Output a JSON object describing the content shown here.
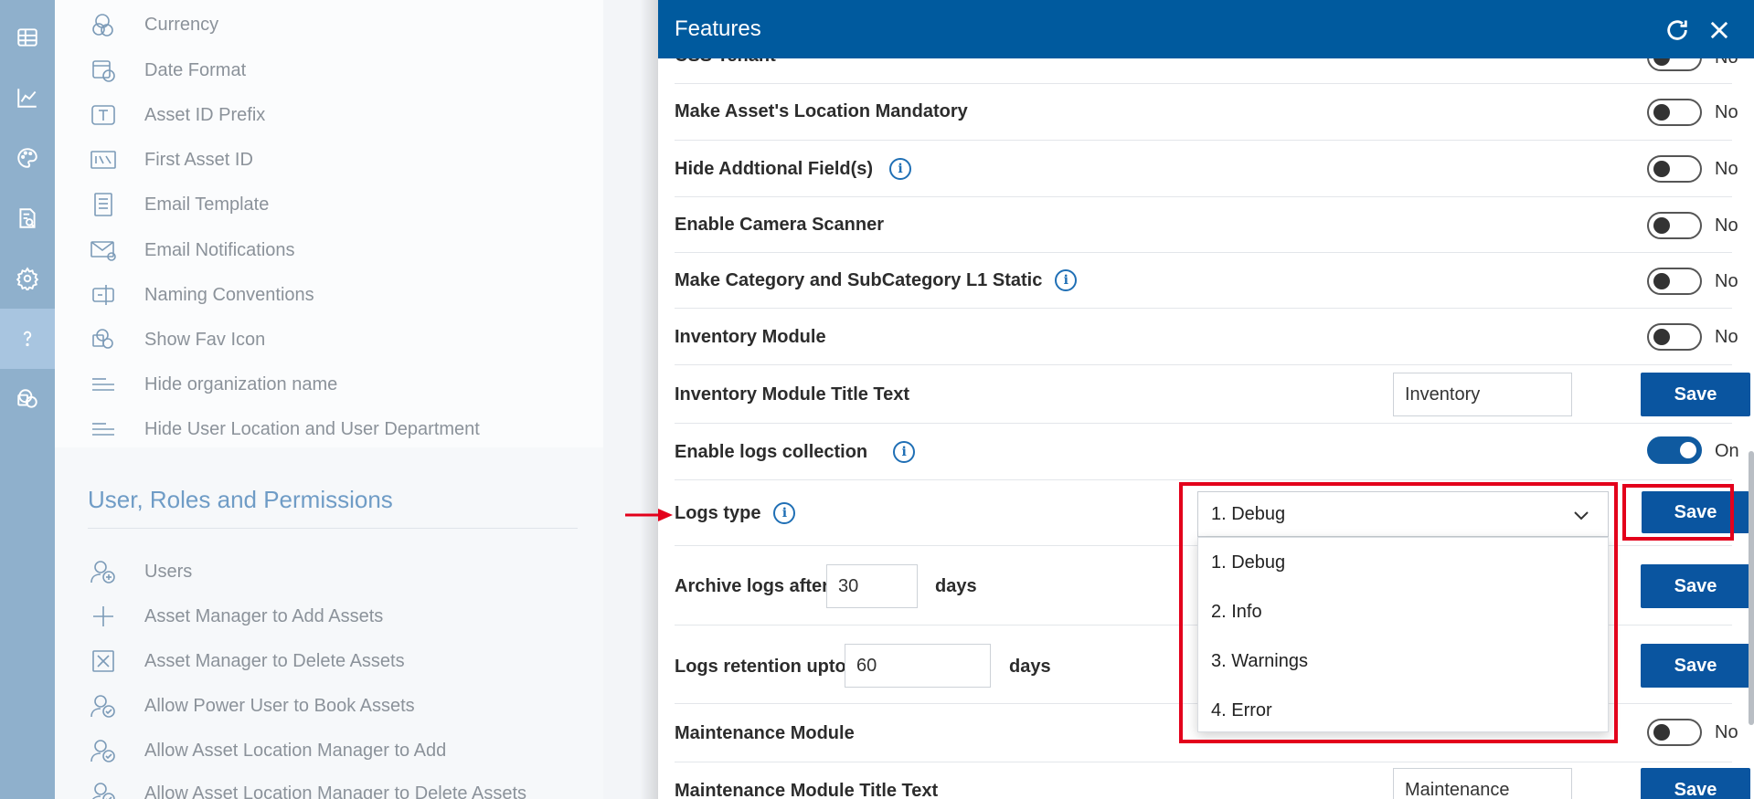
{
  "rail": {
    "items": [
      {
        "icon": "table-icon",
        "active": false
      },
      {
        "icon": "chart-line-icon",
        "active": false
      },
      {
        "icon": "palette-icon",
        "active": false
      },
      {
        "icon": "report-search-icon",
        "active": false
      },
      {
        "icon": "gear-icon",
        "active": false
      },
      {
        "icon": "help-icon",
        "active": true
      },
      {
        "icon": "sharepoint-icon",
        "active": false
      }
    ]
  },
  "settings": {
    "items": [
      {
        "label": "Currency",
        "icon": "currency-icon"
      },
      {
        "label": "Date Format",
        "icon": "calendar-clock-icon"
      },
      {
        "label": "Asset ID Prefix",
        "icon": "text-box-icon"
      },
      {
        "label": "First Asset ID",
        "icon": "number-box-icon"
      },
      {
        "label": "Email Template",
        "icon": "document-list-icon"
      },
      {
        "label": "Email Notifications",
        "icon": "mail-settings-icon"
      },
      {
        "label": "Naming Conventions",
        "icon": "rename-icon"
      },
      {
        "label": "Show Fav Icon",
        "icon": "sharepoint-icon"
      },
      {
        "label": "Hide organization name",
        "icon": "lines-icon"
      },
      {
        "label": "Hide User Location and User Department",
        "icon": "lines-icon"
      }
    ],
    "section_title": "User, Roles and Permissions",
    "section_items": [
      {
        "label": "Users",
        "icon": "user-add-icon"
      },
      {
        "label": "Asset Manager to Add Assets",
        "icon": "plus-icon"
      },
      {
        "label": "Asset Manager to Delete Assets",
        "icon": "delete-box-icon"
      },
      {
        "label": "Allow Power User to Book Assets",
        "icon": "user-check-icon"
      },
      {
        "label": "Allow Asset Location Manager to Add",
        "icon": "user-check-icon"
      },
      {
        "label": "Allow Asset Location Manager to Delete Assets",
        "icon": "user-check-icon"
      }
    ]
  },
  "panel": {
    "title": "Features",
    "partial_label": "CSS Tenant",
    "partial_toggle_text": "No",
    "rows": {
      "location_mandatory": {
        "label": "Make Asset's Location Mandatory",
        "toggle_text": "No"
      },
      "hide_additional": {
        "label": "Hide Addtional Field(s)",
        "toggle_text": "No"
      },
      "camera_scanner": {
        "label": "Enable Camera Scanner",
        "toggle_text": "No"
      },
      "category_static": {
        "label": "Make Category and SubCategory L1 Static",
        "toggle_text": "No"
      },
      "inventory_module": {
        "label": "Inventory Module",
        "toggle_text": "No"
      },
      "inventory_title": {
        "label": "Inventory Module Title Text",
        "value": "Inventory",
        "save": "Save"
      },
      "logs_collection": {
        "label": "Enable logs collection",
        "toggle_text": "On"
      },
      "logs_type": {
        "label": "Logs type",
        "selected": "1. Debug",
        "save": "Save"
      },
      "archive_logs": {
        "label": "Archive logs after",
        "value": "30",
        "unit": "days",
        "save": "Save"
      },
      "logs_retention": {
        "label": "Logs retention upto",
        "value": "60",
        "unit": "days",
        "save": "Save"
      },
      "maintenance_module": {
        "label": "Maintenance Module",
        "toggle_text": "No"
      },
      "maintenance_title": {
        "label": "Maintenance Module Title Text",
        "value": "Maintenance",
        "save": "Save"
      }
    },
    "dropdown_options": [
      "1. Debug",
      "2. Info",
      "3. Warnings",
      "4. Error"
    ]
  },
  "colors": {
    "header": "#005a9e",
    "button": "#0a55a0",
    "highlight": "#e3001b",
    "rail": "#8fb0cc"
  }
}
